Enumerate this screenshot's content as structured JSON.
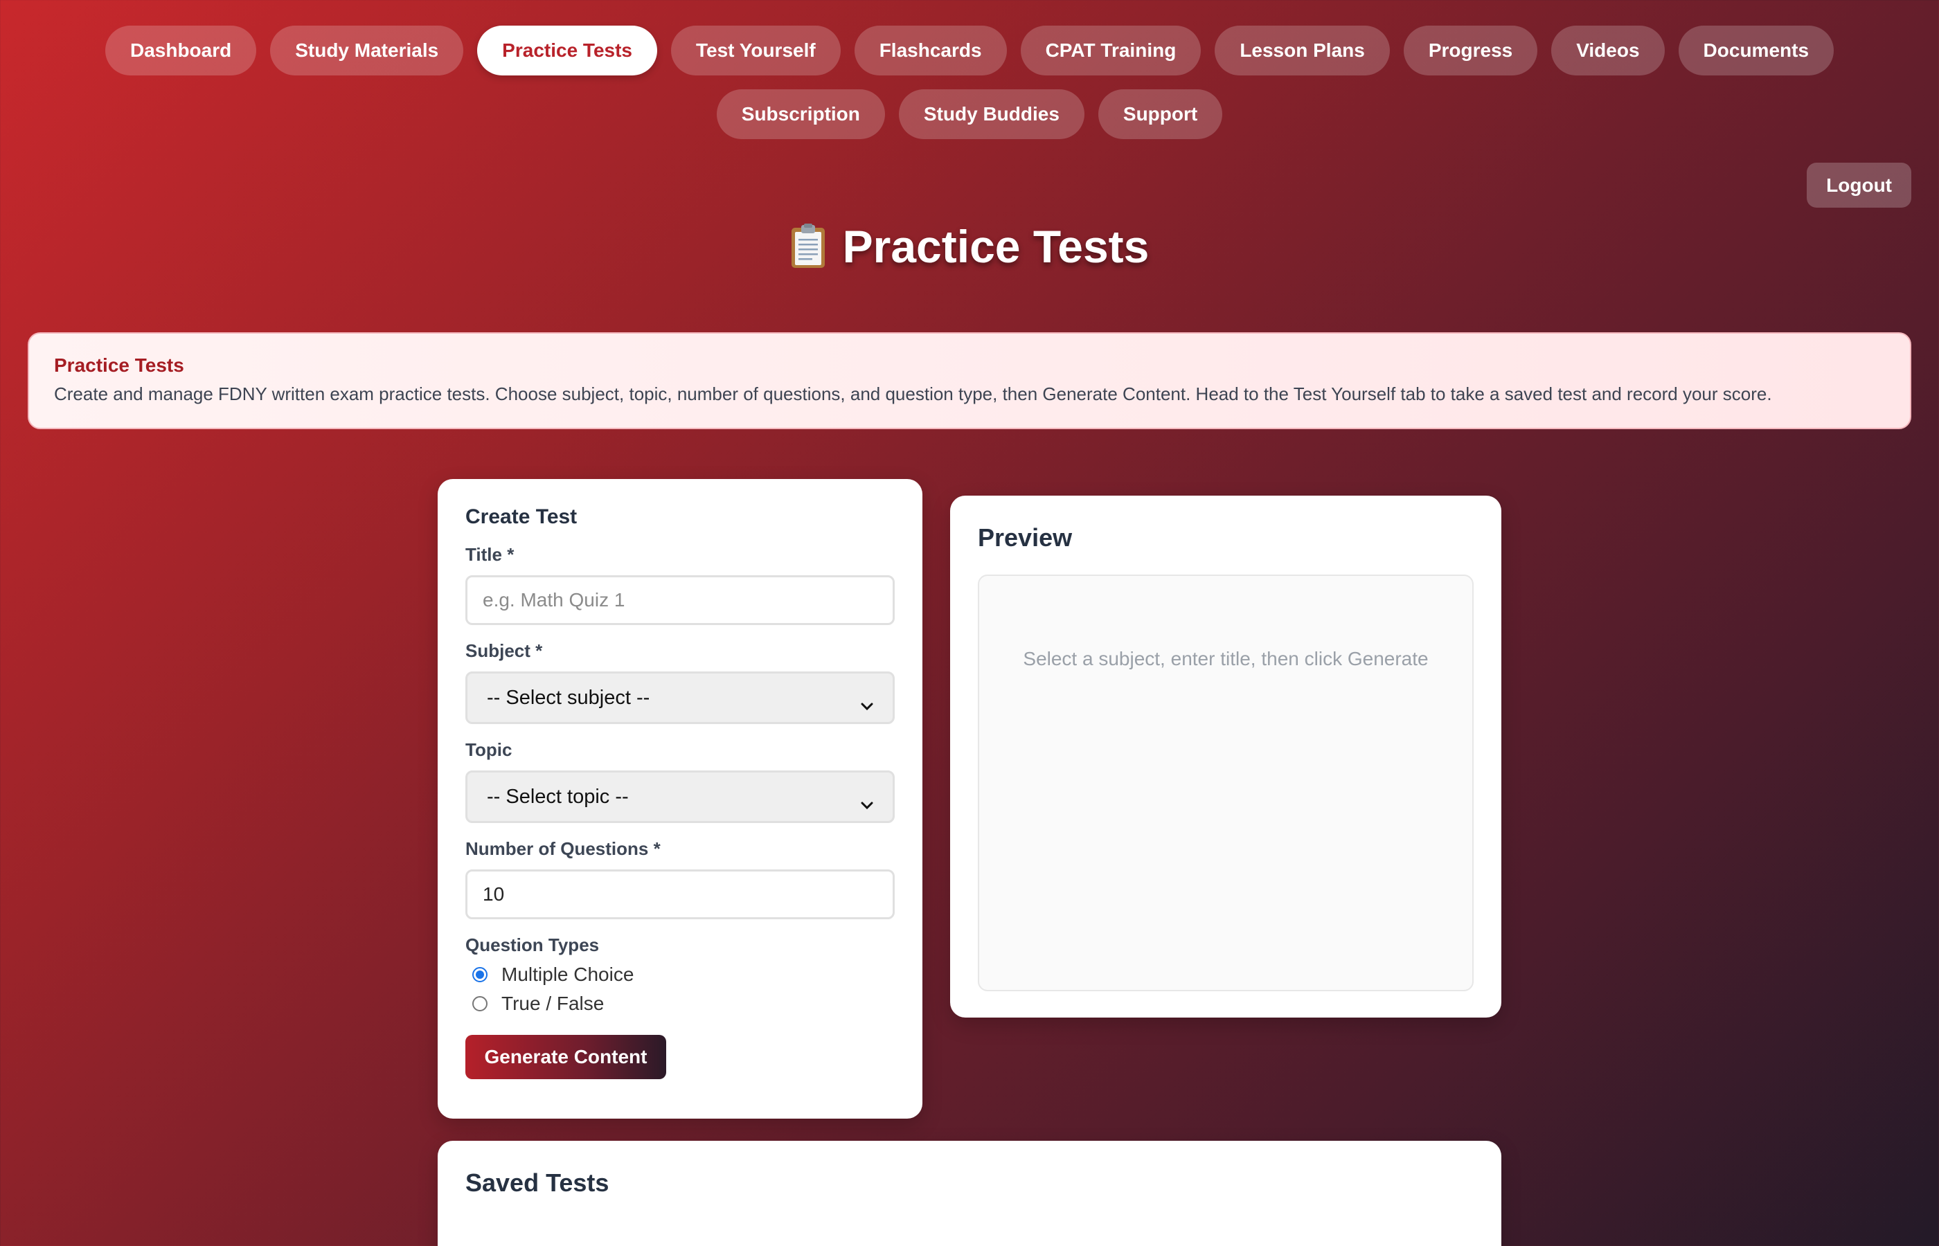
{
  "nav": {
    "items": [
      {
        "label": "Dashboard",
        "active": false
      },
      {
        "label": "Study Materials",
        "active": false
      },
      {
        "label": "Practice Tests",
        "active": true
      },
      {
        "label": "Test Yourself",
        "active": false
      },
      {
        "label": "Flashcards",
        "active": false
      },
      {
        "label": "CPAT Training",
        "active": false
      },
      {
        "label": "Lesson Plans",
        "active": false
      },
      {
        "label": "Progress",
        "active": false
      },
      {
        "label": "Videos",
        "active": false
      },
      {
        "label": "Documents",
        "active": false
      },
      {
        "label": "Subscription",
        "active": false
      },
      {
        "label": "Study Buddies",
        "active": false
      },
      {
        "label": "Support",
        "active": false
      }
    ]
  },
  "header": {
    "logout_label": "Logout",
    "title": "Practice Tests",
    "title_icon": "clipboard-icon"
  },
  "info": {
    "title": "Practice Tests",
    "text": "Create and manage FDNY written exam practice tests. Choose subject, topic, number of questions, and question type, then Generate Content. Head to the Test Yourself tab to take a saved test and record your score."
  },
  "create": {
    "heading": "Create Test",
    "title_label": "Title *",
    "title_value": "",
    "title_placeholder": "e.g. Math Quiz 1",
    "subject_label": "Subject *",
    "subject_selected": "-- Select subject --",
    "topic_label": "Topic",
    "topic_selected": "-- Select topic --",
    "num_label": "Number of Questions *",
    "num_value": "10",
    "types_label": "Question Types",
    "types": [
      {
        "label": "Multiple Choice",
        "checked": true
      },
      {
        "label": "True / False",
        "checked": false
      }
    ],
    "generate_label": "Generate Content"
  },
  "preview": {
    "heading": "Preview",
    "empty_text": "Select a subject, enter title, then click Generate"
  },
  "saved": {
    "heading": "Saved Tests"
  },
  "colors": {
    "accent": "#b8222a",
    "radio": "#1a73e8"
  }
}
